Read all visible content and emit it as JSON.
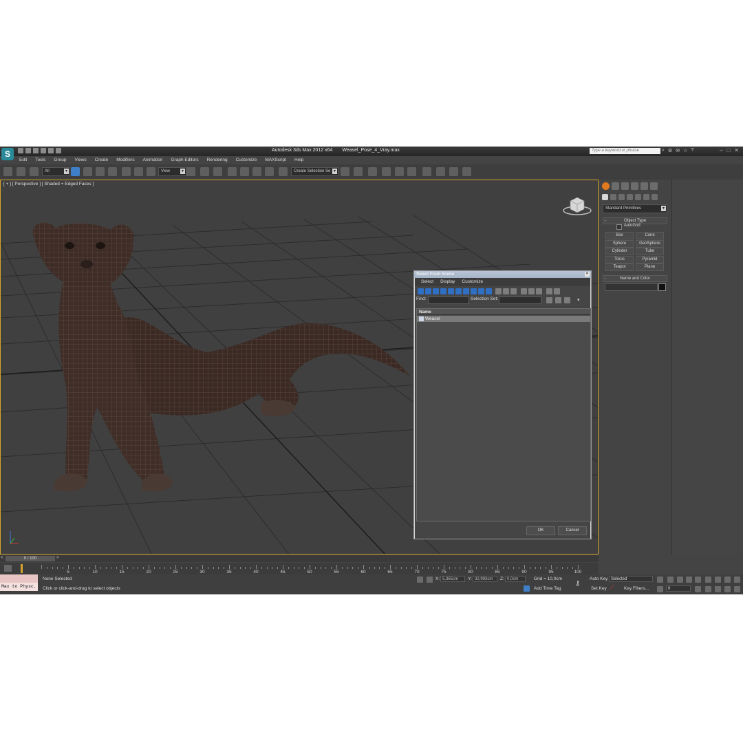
{
  "window": {
    "app_title": "Autodesk 3ds Max  2012 x64",
    "file_name": "Weasel_Pose_4_Vray.max",
    "search_placeholder": "Type a keyword or phrase"
  },
  "menu": [
    "Edit",
    "Tools",
    "Group",
    "Views",
    "Create",
    "Modifiers",
    "Animation",
    "Graph Editors",
    "Rendering",
    "Customize",
    "MAXScript",
    "Help"
  ],
  "toolbar": {
    "filter_value": "All",
    "refcoord_value": "View",
    "selection_set_value": "Create Selection Se"
  },
  "viewport": {
    "label": "[ + ] [ Perspective ] [ Shaded + Edged Faces ]",
    "active_border_color": "#d6a52a"
  },
  "command_panel": {
    "category": "Standard Primitives",
    "object_type_header": "Object Type",
    "autogrid_label": "AutoGrid",
    "buttons": [
      "Box",
      "Cone",
      "Sphere",
      "GeoSphere",
      "Cylinder",
      "Tube",
      "Torus",
      "Pyramid",
      "Teapot",
      "Plane"
    ],
    "name_color_header": "Name and Color"
  },
  "dialog": {
    "title": "Select From Scene",
    "menu": [
      "Select",
      "Display",
      "Customize"
    ],
    "find_label": "Find:",
    "selection_set_label": "Selection Set:",
    "column_header": "Name",
    "items": [
      "Weasel"
    ],
    "ok_label": "OK",
    "cancel_label": "Cancel"
  },
  "timeline": {
    "slider_label": "0 / 100",
    "ticks": [
      "5",
      "10",
      "15",
      "20",
      "25",
      "30",
      "35",
      "40",
      "45",
      "50",
      "55",
      "60",
      "65",
      "70",
      "75",
      "80",
      "85",
      "90",
      "95",
      "100"
    ]
  },
  "status": {
    "maxscript_text": "Max to Physc.",
    "selection_status": "None Selected",
    "prompt": "Click or click-and-drag to select objects",
    "x_label": "X:",
    "x_value": "5,365cm",
    "y_label": "Y:",
    "y_value": "32,993cm",
    "z_label": "Z:",
    "z_value": "0,0cm",
    "grid": "Grid = 10,0cm",
    "add_time_tag": "Add Time Tag",
    "auto_key": "Auto Key",
    "set_key": "Set Key",
    "key_mode_value": "Selected",
    "key_filters": "Key Filters...",
    "frame_value": "0"
  }
}
